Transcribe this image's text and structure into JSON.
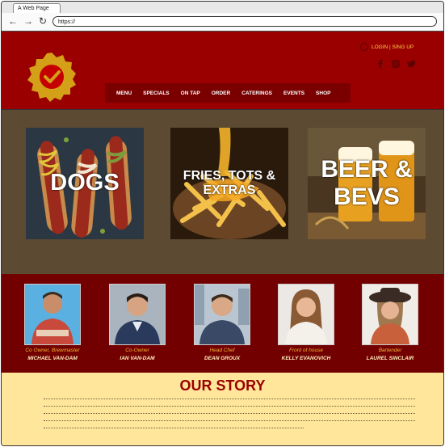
{
  "browser": {
    "tab_title": "A Web Page",
    "url": "https://"
  },
  "header": {
    "login": "LOGIN | SING UP",
    "nav": [
      "MENU",
      "SPECIALS",
      "ON TAP",
      "ORDER",
      "CATERINGS",
      "EVENTS",
      "SHOP"
    ],
    "social": [
      "facebook-icon",
      "instagram-icon",
      "twitter-icon"
    ]
  },
  "products": [
    {
      "label": "DOGS"
    },
    {
      "label": "FRIES, TOTS & EXTRAS"
    },
    {
      "label": "BEER & BEVS"
    }
  ],
  "team": [
    {
      "role": "Co Owner, Brewmaster",
      "name": "MICHAEL VAN-DAM"
    },
    {
      "role": "Co-Owner",
      "name": "IAN VAN-DAM"
    },
    {
      "role": "Head Chef",
      "name": "DEAN GROUX"
    },
    {
      "role": "Front of house",
      "name": "KELLY EVANOVICH"
    },
    {
      "role": "Bartender",
      "name": "LAUREL SINCLAIR"
    }
  ],
  "story": {
    "title": "OUR STORY"
  },
  "colors": {
    "brand_red": "#9a0000",
    "accent_gold": "#ffd24a",
    "story_bg": "#ffe69a"
  }
}
